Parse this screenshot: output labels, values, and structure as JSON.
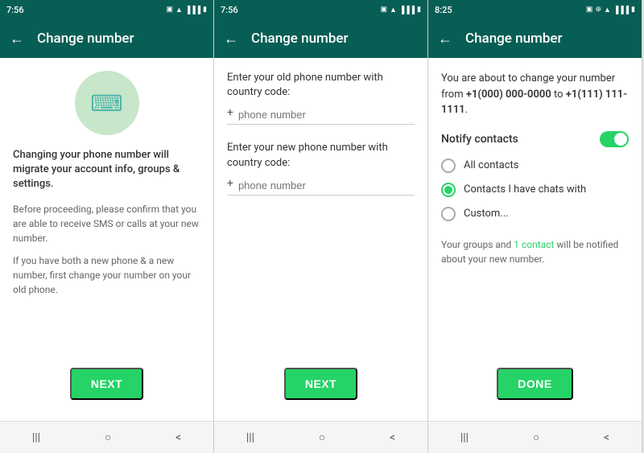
{
  "screen1": {
    "status_time": "7:56",
    "header_title": "Change number",
    "icon_symbol": "⌨",
    "main_text": "Changing your phone number will migrate your account info, groups & settings.",
    "sub_text1": "Before proceeding, please confirm that you are able to receive SMS or calls at your new number.",
    "sub_text2": "If you have both a new phone & a new number, first change your number on your old phone.",
    "next_button": "NEXT"
  },
  "screen2": {
    "status_time": "7:56",
    "header_title": "Change number",
    "old_label": "Enter your old phone number with country code:",
    "old_placeholder": "phone number",
    "new_label": "Enter your new phone number with country code:",
    "new_placeholder": "phone number",
    "next_button": "NEXT"
  },
  "screen3": {
    "status_time": "8:25",
    "header_title": "Change number",
    "change_desc_pre": "You are about to change your number from ",
    "old_number": "+1(000) 000-0000",
    "change_desc_mid": " to ",
    "new_number": "+1(111) 111-1111",
    "change_desc_post": ".",
    "notify_label": "Notify contacts",
    "radio_all": "All contacts",
    "radio_chats": "Contacts I have chats with",
    "radio_custom": "Custom...",
    "group_notice_pre": "Your groups and ",
    "group_notice_link": "1 contact",
    "group_notice_post": " will be notified about your new number.",
    "done_button": "DONE"
  },
  "nav": {
    "menu": "|||",
    "home": "○",
    "back": "<"
  },
  "colors": {
    "header_bg": "#075E54",
    "accent": "#25D366",
    "text_dark": "#333333",
    "text_light": "#666666"
  }
}
